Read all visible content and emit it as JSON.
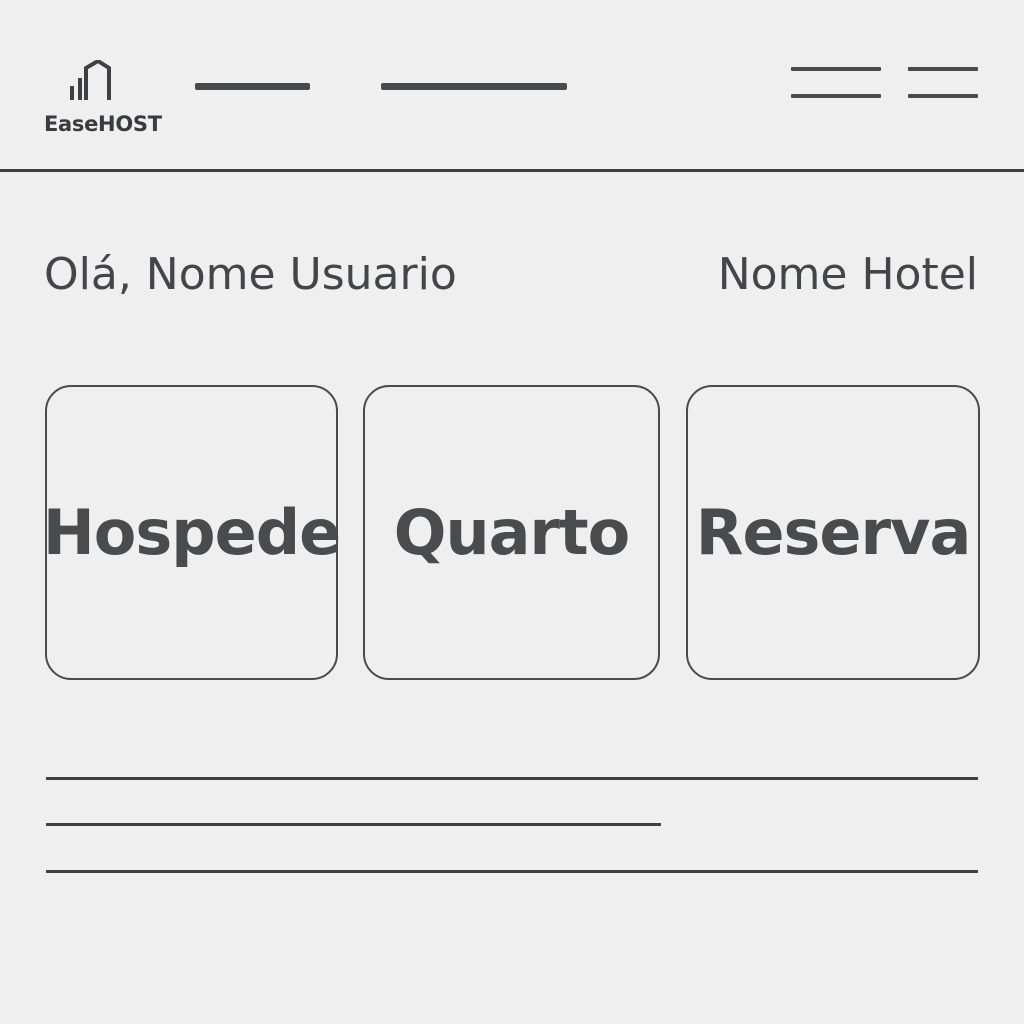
{
  "header": {
    "brand": "EaseHOST",
    "logo_icon": "house-signal-icon",
    "nav_placeholders": [
      "nav-link-placeholder-1",
      "nav-link-placeholder-2"
    ],
    "menu_icons": [
      "menu-icon-1",
      "menu-icon-2"
    ]
  },
  "welcome": {
    "greeting": "Olá, Nome Usuario",
    "hotel_name": "Nome Hotel"
  },
  "cards": [
    {
      "label": "Hospede"
    },
    {
      "label": "Quarto"
    },
    {
      "label": "Reserva"
    }
  ],
  "colors": {
    "background": "#efeff0",
    "stroke": "#3f4042",
    "text": "#444547"
  }
}
